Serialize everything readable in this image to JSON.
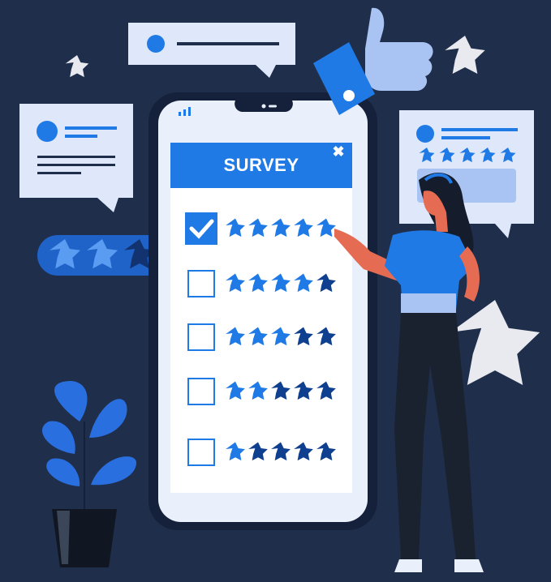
{
  "survey": {
    "title": "SURVEY",
    "close_symbol": "✖",
    "rows": [
      {
        "checked": true,
        "rating": 5
      },
      {
        "checked": false,
        "rating": 4
      },
      {
        "checked": false,
        "rating": 3
      },
      {
        "checked": false,
        "rating": 2
      },
      {
        "checked": false,
        "rating": 1
      }
    ],
    "max_stars": 5
  },
  "left_badge": {
    "rating": 2,
    "max_stars": 3
  },
  "right_card": {
    "rating": 5,
    "max_stars": 5
  },
  "colors": {
    "background": "#1f2e4b",
    "accent_blue": "#1f7ae6",
    "dark_blue": "#0f3f8f",
    "light_blue": "#dfe8fb",
    "paper": "#e7edf9",
    "star_pale": "#e8eaf0",
    "plant": "#2a6fe0",
    "pants": "#1a2230",
    "hair": "#151c2b"
  },
  "icons": [
    "check-icon",
    "close-icon",
    "star-icon",
    "thumbs-up-icon",
    "signal-icon",
    "plant-icon"
  ]
}
